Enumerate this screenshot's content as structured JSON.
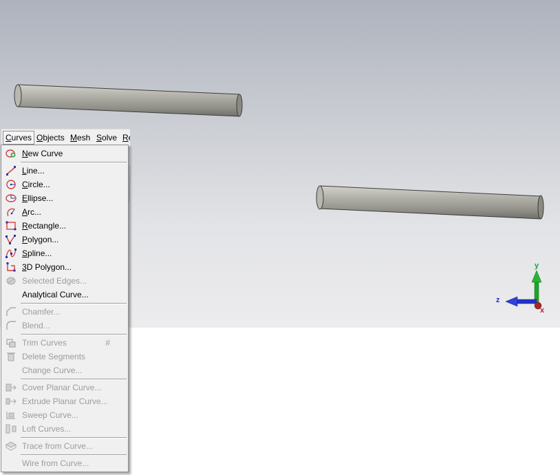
{
  "menubar": {
    "items": [
      {
        "label": "Curves",
        "active": true
      },
      {
        "label": "Objects"
      },
      {
        "label": "Mesh"
      },
      {
        "label": "Solve"
      },
      {
        "label": "Re"
      }
    ]
  },
  "curves_menu": {
    "items": [
      {
        "label": "New Curve",
        "icon": "new-curve-icon",
        "enabled": true
      },
      {
        "label": "Line...",
        "icon": "line-icon",
        "enabled": true
      },
      {
        "label": "Circle...",
        "icon": "circle-icon",
        "enabled": true
      },
      {
        "label": "Ellipse...",
        "icon": "ellipse-icon",
        "enabled": true
      },
      {
        "label": "Arc...",
        "icon": "arc-icon",
        "enabled": true
      },
      {
        "label": "Rectangle...",
        "icon": "rectangle-icon",
        "enabled": true
      },
      {
        "label": "Polygon...",
        "icon": "polygon-icon",
        "enabled": true
      },
      {
        "label": "Spline...",
        "icon": "spline-icon",
        "enabled": true
      },
      {
        "label": "3D Polygon...",
        "icon": "3d-polygon-icon",
        "enabled": true
      },
      {
        "label": "Selected Edges...",
        "icon": "selected-edges-icon",
        "enabled": false
      },
      {
        "label": "Analytical Curve...",
        "icon": "",
        "enabled": true
      },
      {
        "label": "Chamfer...",
        "icon": "chamfer-icon",
        "enabled": false
      },
      {
        "label": "Blend...",
        "icon": "blend-icon",
        "enabled": false
      },
      {
        "label": "Trim Curves",
        "icon": "trim-curves-icon",
        "enabled": false,
        "shortcut": "#"
      },
      {
        "label": "Delete Segments",
        "icon": "delete-segments-icon",
        "enabled": false
      },
      {
        "label": "Change Curve...",
        "icon": "",
        "enabled": false
      },
      {
        "label": "Cover Planar Curve...",
        "icon": "cover-planar-icon",
        "enabled": false
      },
      {
        "label": "Extrude Planar Curve...",
        "icon": "extrude-planar-icon",
        "enabled": false
      },
      {
        "label": "Sweep Curve...",
        "icon": "sweep-curve-icon",
        "enabled": false
      },
      {
        "label": "Loft Curves...",
        "icon": "loft-curves-icon",
        "enabled": false
      },
      {
        "label": "Trace from Curve...",
        "icon": "trace-from-curve-icon",
        "enabled": false
      },
      {
        "label": "Wire from Curve...",
        "icon": "",
        "enabled": false
      }
    ]
  },
  "triad": {
    "y_label": "y",
    "z_label": "z",
    "x_label": "x",
    "y_color": "#1fa32b",
    "z_color": "#2431c9",
    "x_color": "#c0262b"
  },
  "colors": {
    "cylinder_body": "#a4a49c",
    "menu_bg": "#f0f0f0",
    "disabled_text": "#9c9c9c"
  }
}
